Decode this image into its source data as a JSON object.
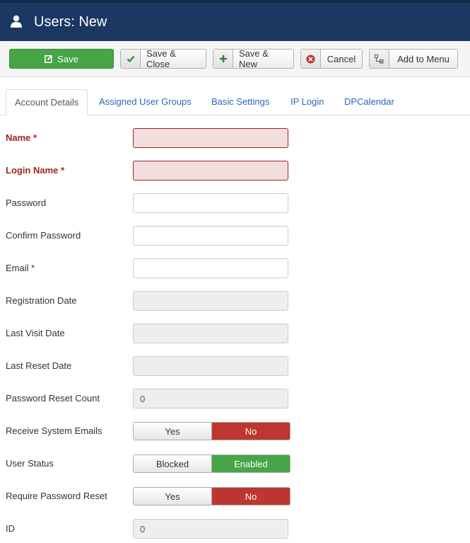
{
  "header": {
    "title": "Users: New",
    "icon": "user-icon"
  },
  "toolbar": {
    "save": "Save",
    "save_close": "Save & Close",
    "save_new": "Save & New",
    "cancel": "Cancel",
    "add_to_menu": "Add to Menu"
  },
  "tabs": [
    {
      "label": "Account Details",
      "active": true
    },
    {
      "label": "Assigned User Groups",
      "active": false
    },
    {
      "label": "Basic Settings",
      "active": false
    },
    {
      "label": "IP Login",
      "active": false
    },
    {
      "label": "DPCalendar",
      "active": false
    }
  ],
  "form": {
    "name": {
      "label": "Name *",
      "value": ""
    },
    "login_name": {
      "label": "Login Name *",
      "value": ""
    },
    "password": {
      "label": "Password",
      "value": ""
    },
    "confirm_password": {
      "label": "Confirm Password",
      "value": ""
    },
    "email": {
      "label": "Email *",
      "value": ""
    },
    "registration_date": {
      "label": "Registration Date",
      "value": ""
    },
    "last_visit_date": {
      "label": "Last Visit Date",
      "value": ""
    },
    "last_reset_date": {
      "label": "Last Reset Date",
      "value": ""
    },
    "password_reset_count": {
      "label": "Password Reset Count",
      "value": "0"
    },
    "receive_system_emails": {
      "label": "Receive System Emails",
      "options": [
        "Yes",
        "No"
      ],
      "selected": "No"
    },
    "user_status": {
      "label": "User Status",
      "options": [
        "Blocked",
        "Enabled"
      ],
      "selected": "Enabled"
    },
    "require_password_reset": {
      "label": "Require Password Reset",
      "options": [
        "Yes",
        "No"
      ],
      "selected": "No"
    },
    "id": {
      "label": "ID",
      "value": "0"
    }
  },
  "colors": {
    "header_bg": "#1b3762",
    "save_green": "#46a546",
    "danger_red": "#bd362f",
    "required_text": "#9d261d",
    "link_blue": "#2a69b8"
  }
}
